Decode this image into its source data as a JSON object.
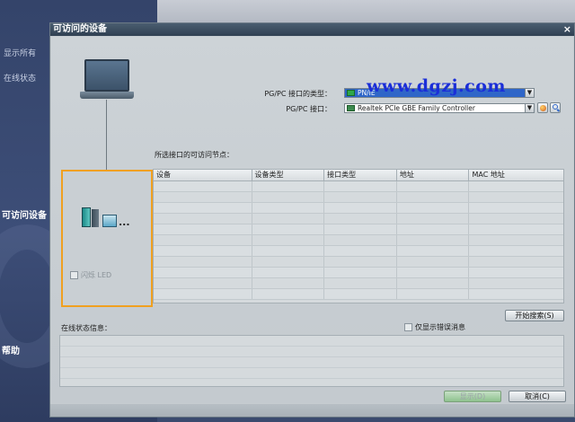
{
  "background": {
    "items": [
      "显示所有",
      "在线状态"
    ],
    "section": "可访问设备",
    "help": "帮助"
  },
  "dialog": {
    "title": "可访问的设备",
    "close": "×"
  },
  "form": {
    "pgpc_type_label": "PG/PC 接口的类型：",
    "pgpc_type_value": "PN/IE",
    "pgpc_if_label": "PG/PC 接口：",
    "pgpc_if_value": "Realtek PCIe GBE Family Controller"
  },
  "watermark": "www.dgzj.com",
  "nodes": {
    "title": "所选接口的可访问节点：",
    "columns": [
      "设备",
      "设备类型",
      "接口类型",
      "地址",
      "MAC 地址"
    ]
  },
  "flash_led_label": "闪烁 LED",
  "start_search_label": "开始搜索(S)",
  "status": {
    "title": "在线状态信息：",
    "only_errors_label": "仅显示错误消息"
  },
  "footer": {
    "show_label": "显示(D)",
    "cancel_label": "取消(C)"
  },
  "colors": {
    "selection": "#2f66c8",
    "node_highlight": "#f0a020",
    "watermark": "#1a2ed8"
  }
}
